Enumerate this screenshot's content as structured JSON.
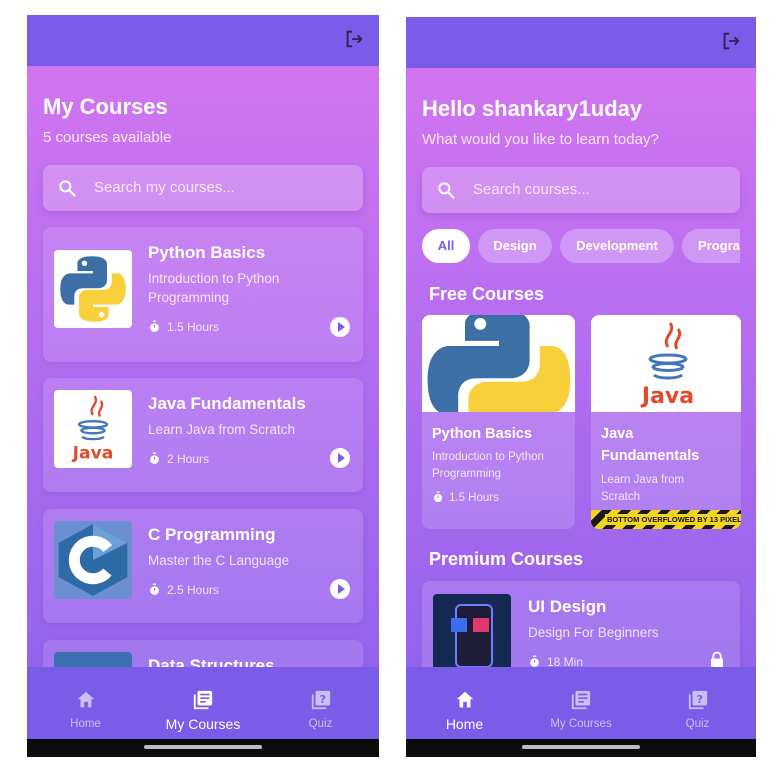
{
  "my_courses_screen": {
    "title": "My Courses",
    "subtitle": "5 courses available",
    "search_placeholder": "Search my courses...",
    "courses": [
      {
        "title": "Python Basics",
        "description": "Introduction to Python Programming",
        "duration": "1.5 Hours",
        "icon": "python-logo"
      },
      {
        "title": "Java Fundamentals",
        "description": "Learn Java from Scratch",
        "duration": "2 Hours",
        "icon": "java-logo"
      },
      {
        "title": "C Programming",
        "description": "Master the C Language",
        "duration": "2.5 Hours",
        "icon": "c-logo"
      },
      {
        "title": "Data Structures",
        "description": "",
        "duration": "",
        "icon": "data-structures-thumbnail"
      }
    ],
    "nav": [
      {
        "label": "Home",
        "icon": "home-icon",
        "active": false
      },
      {
        "label": "My Courses",
        "icon": "library-icon",
        "active": true
      },
      {
        "label": "Quiz",
        "icon": "quiz-icon",
        "active": false
      }
    ]
  },
  "home_screen": {
    "greeting": "Hello shankary1uday",
    "subtitle": "What would you like to learn today?",
    "search_placeholder": "Search courses...",
    "categories": [
      "All",
      "Design",
      "Development",
      "Progra"
    ],
    "selected_category": "All",
    "free_section_title": "Free Courses",
    "free_courses": [
      {
        "title": "Python Basics",
        "description": "Introduction to Python Programming",
        "duration": "1.5 Hours",
        "icon": "python-logo"
      },
      {
        "title": "Java Fundamentals",
        "description": "Learn Java from Scratch",
        "duration": "",
        "icon": "java-logo"
      }
    ],
    "overflow_warning": "BOTTOM OVERFLOWED BY 13 PIXELS",
    "premium_section_title": "Premium Courses",
    "premium_courses": [
      {
        "title": "UI Design",
        "description": "Design For Beginners",
        "duration": "18 Min",
        "locked": true,
        "icon": "ui-ux-thumbnail"
      }
    ],
    "nav": [
      {
        "label": "Home",
        "icon": "home-icon",
        "active": true
      },
      {
        "label": "My Courses",
        "icon": "library-icon",
        "active": false
      },
      {
        "label": "Quiz",
        "icon": "quiz-icon",
        "active": false
      }
    ]
  },
  "colors": {
    "top_bar": "#7a5ce8",
    "gradient_top": "#d776ef",
    "gradient_bottom": "#8b61ec",
    "accent": "#7b5ce6"
  }
}
